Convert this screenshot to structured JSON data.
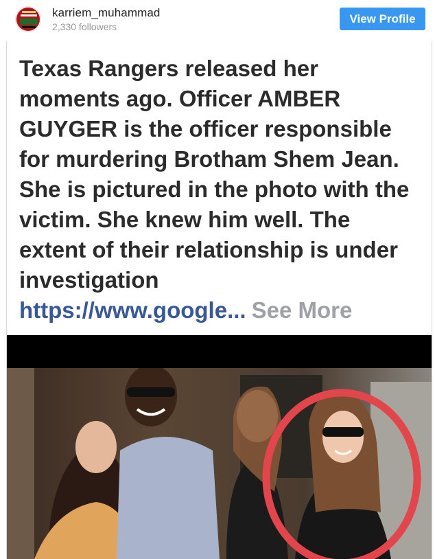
{
  "header": {
    "username": "karriem_muhammad",
    "followers": "2,330 followers",
    "view_profile_label": "View Profile"
  },
  "post": {
    "caption_lines": [
      "Texas Rangers released her",
      "moments ago. Officer AMBER",
      "GUYGER is the officer responsible",
      "for murdering Brotham Shem Jean.",
      "She is pictured in the photo with the",
      "victim. She knew him well. The",
      "extent of their relationship is under",
      "investigation"
    ],
    "link_text": "https://www.google",
    "ellipsis": "...",
    "see_more_label": "See More"
  },
  "colors": {
    "accent_button": "#3897f0",
    "link": "#385898",
    "see_more": "#9ea1a6",
    "circle_highlight": "#e2454b"
  }
}
